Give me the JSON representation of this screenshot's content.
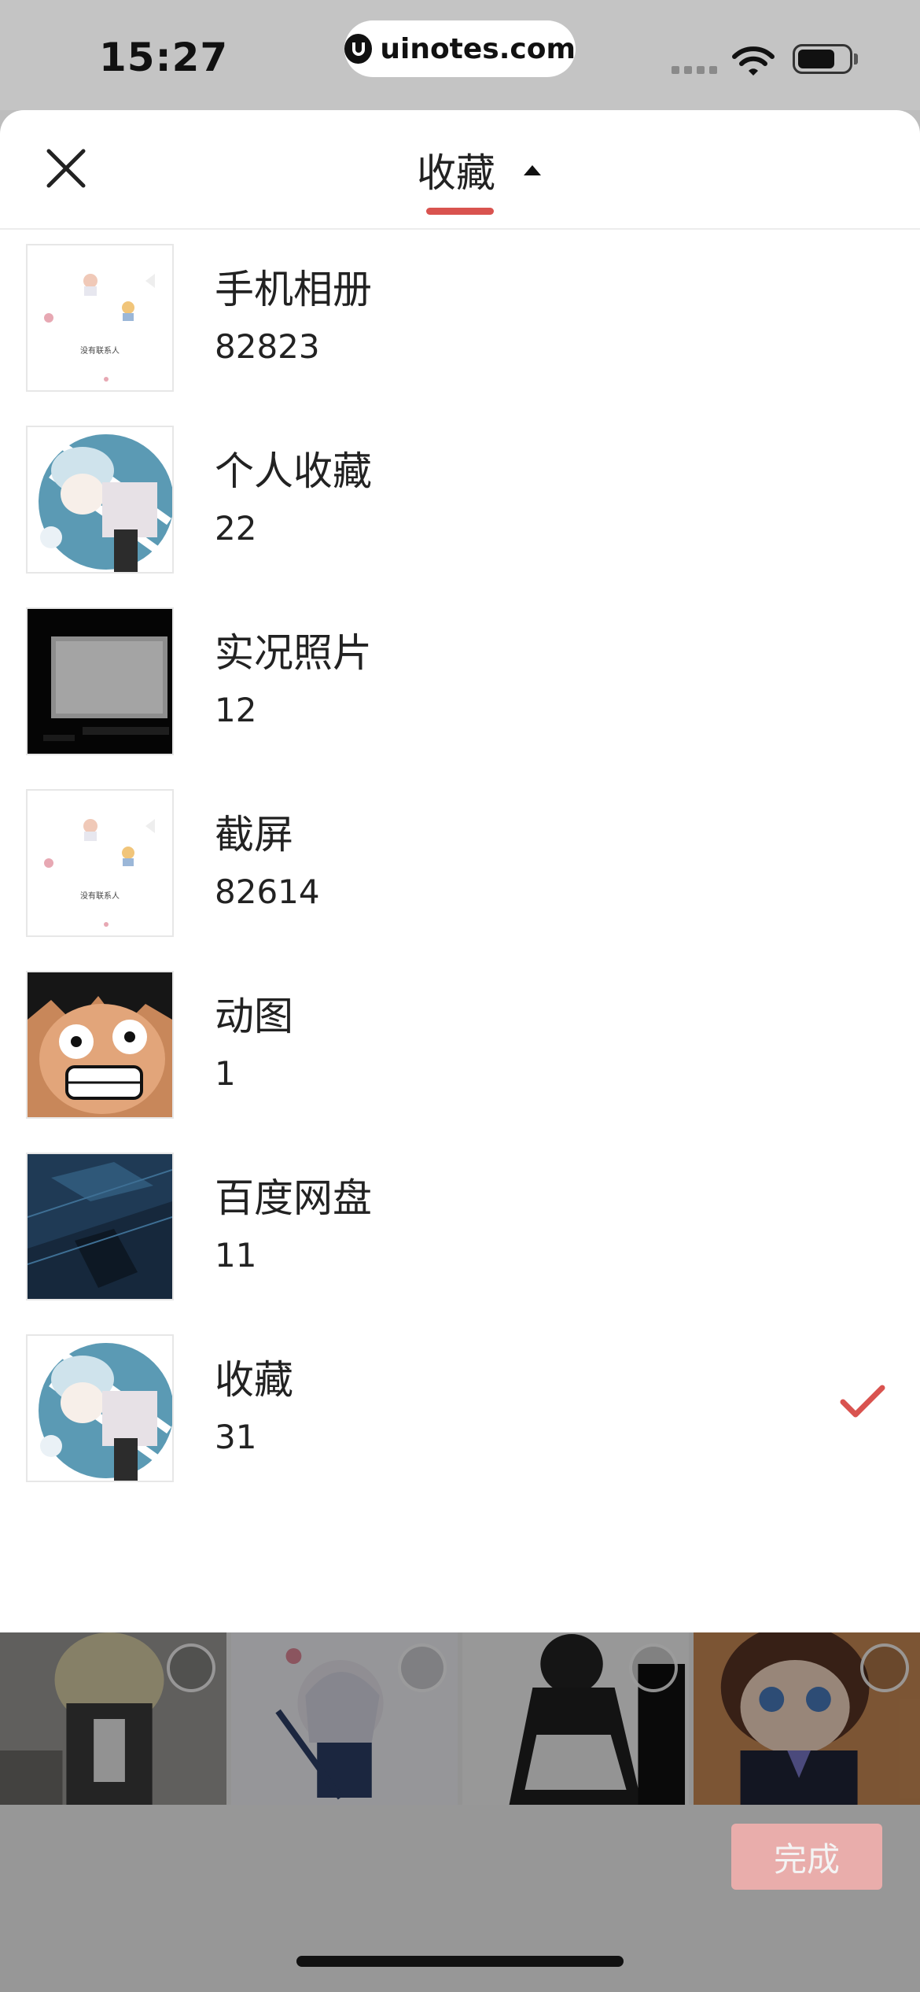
{
  "status_bar": {
    "time": "15:27",
    "url": "uinotes.com"
  },
  "sheet": {
    "title": "收藏",
    "accent_color": "#d9534f"
  },
  "albums": [
    {
      "name": "手机相册",
      "count": "82823",
      "thumb": "contacts-screenshot",
      "selected": false
    },
    {
      "name": "个人收藏",
      "count": "22",
      "thumb": "anime-girl-blue",
      "selected": false
    },
    {
      "name": "实况照片",
      "count": "12",
      "thumb": "dark-monitor",
      "selected": false
    },
    {
      "name": "截屏",
      "count": "82614",
      "thumb": "contacts-screenshot",
      "selected": false
    },
    {
      "name": "动图",
      "count": "1",
      "thumb": "luffy-grin",
      "selected": false
    },
    {
      "name": "百度网盘",
      "count": "11",
      "thumb": "dark-blue-room",
      "selected": false
    },
    {
      "name": "收藏",
      "count": "31",
      "thumb": "anime-girl-blue",
      "selected": true
    }
  ],
  "contacts_thumb_text": "没有联系人",
  "footer": {
    "done_label": "完成"
  }
}
